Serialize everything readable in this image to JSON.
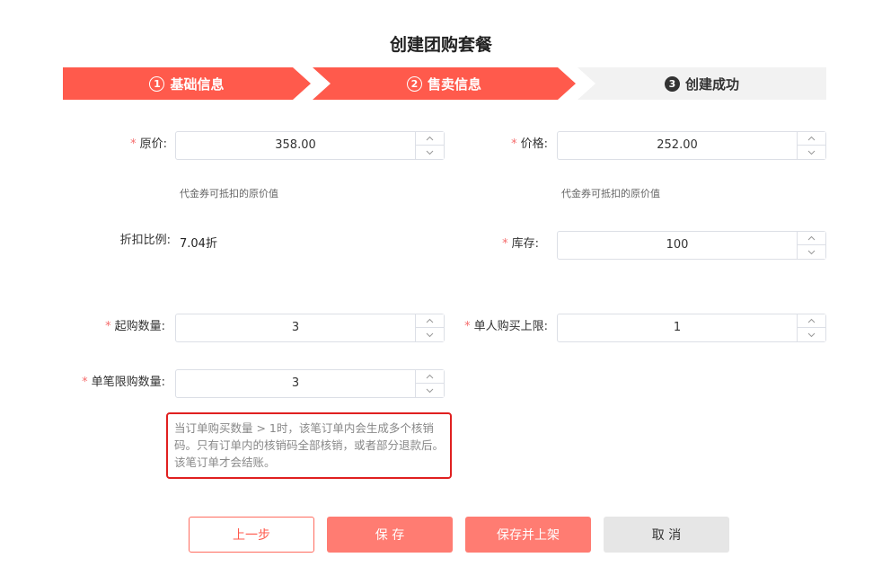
{
  "page": {
    "title": "创建团购套餐"
  },
  "steps": [
    {
      "num": "1",
      "label": "基础信息"
    },
    {
      "num": "2",
      "label": "售卖信息"
    },
    {
      "num": "3",
      "label": "创建成功"
    }
  ],
  "form": {
    "required_mark": "*",
    "original_price": {
      "label": "原价:",
      "value": "358.00",
      "hint": "代金券可抵扣的原价值"
    },
    "price": {
      "label": "价格:",
      "value": "252.00",
      "hint": "代金券可抵扣的原价值"
    },
    "discount": {
      "label": "折扣比例:",
      "value": "7.04折"
    },
    "stock": {
      "label": "库存:",
      "value": "100"
    },
    "min_purchase": {
      "label": "起购数量:",
      "value": "3"
    },
    "per_user_limit": {
      "label": "单人购买上限:",
      "value": "1"
    },
    "per_order_limit": {
      "label": "单笔限购数量:",
      "value": "3"
    },
    "notice": "当订单购买数量 > 1时，该笔订单内会生成多个核销码。只有订单内的核销码全部核销，或者部分退款后。该笔订单才会结账。"
  },
  "buttons": {
    "prev": "上一步",
    "save": "保 存",
    "save_publish": "保存并上架",
    "cancel": "取 消"
  },
  "colors": {
    "accent": "#ff5a4c",
    "button_fill": "#ff7c72",
    "notice_border": "#e02020"
  }
}
